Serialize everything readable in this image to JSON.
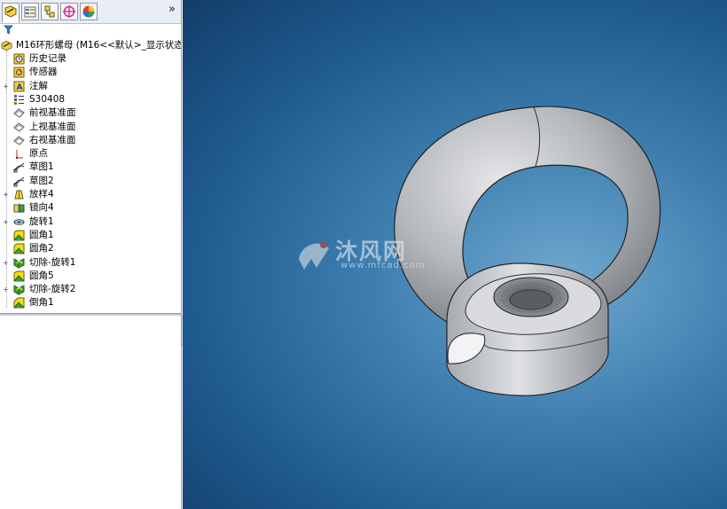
{
  "panel": {
    "tabs": [
      "feature-manager-icon",
      "property-manager-icon",
      "configuration-manager-icon",
      "dimxpert-icon",
      "display-manager-icon"
    ],
    "more_symbol": "»"
  },
  "tree": {
    "root_label": "M16环形螺母  (M16<<默认>_显示状态",
    "items": [
      {
        "label": "历史记录",
        "icon": "history-icon",
        "expandable": false
      },
      {
        "label": "传感器",
        "icon": "sensor-icon",
        "expandable": false
      },
      {
        "label": "注解",
        "icon": "annotation-icon",
        "expandable": true
      },
      {
        "label": "S30408",
        "icon": "material-icon",
        "expandable": false
      },
      {
        "label": "前视基准面",
        "icon": "plane-icon",
        "expandable": false
      },
      {
        "label": "上视基准面",
        "icon": "plane-icon",
        "expandable": false
      },
      {
        "label": "右视基准面",
        "icon": "plane-icon",
        "expandable": false
      },
      {
        "label": "原点",
        "icon": "origin-icon",
        "expandable": false
      },
      {
        "label": "草图1",
        "icon": "sketch-icon",
        "expandable": false
      },
      {
        "label": "草图2",
        "icon": "sketch-icon",
        "expandable": false
      },
      {
        "label": "放样4",
        "icon": "loft-icon",
        "expandable": true
      },
      {
        "label": "镜向4",
        "icon": "mirror-icon",
        "expandable": false
      },
      {
        "label": "旋转1",
        "icon": "revolve-icon",
        "expandable": true
      },
      {
        "label": "圆角1",
        "icon": "fillet-icon",
        "expandable": false
      },
      {
        "label": "圆角2",
        "icon": "fillet-icon",
        "expandable": false
      },
      {
        "label": "切除-旋转1",
        "icon": "cut-revolve-icon",
        "expandable": true
      },
      {
        "label": "圆角5",
        "icon": "fillet-icon",
        "expandable": false
      },
      {
        "label": "切除-旋转2",
        "icon": "cut-revolve-icon",
        "expandable": true
      },
      {
        "label": "倒角1",
        "icon": "chamfer-icon",
        "expandable": false
      }
    ]
  },
  "watermark": {
    "text": "沐风网",
    "url": "www.mfcad.com"
  },
  "colors": {
    "viewport_top": "#123d6a",
    "viewport_center": "#6fa8cf",
    "part_gray": "#b9bcc0",
    "fillet_yellow": "#f2e200",
    "sketch_green": "#3aa04a"
  }
}
